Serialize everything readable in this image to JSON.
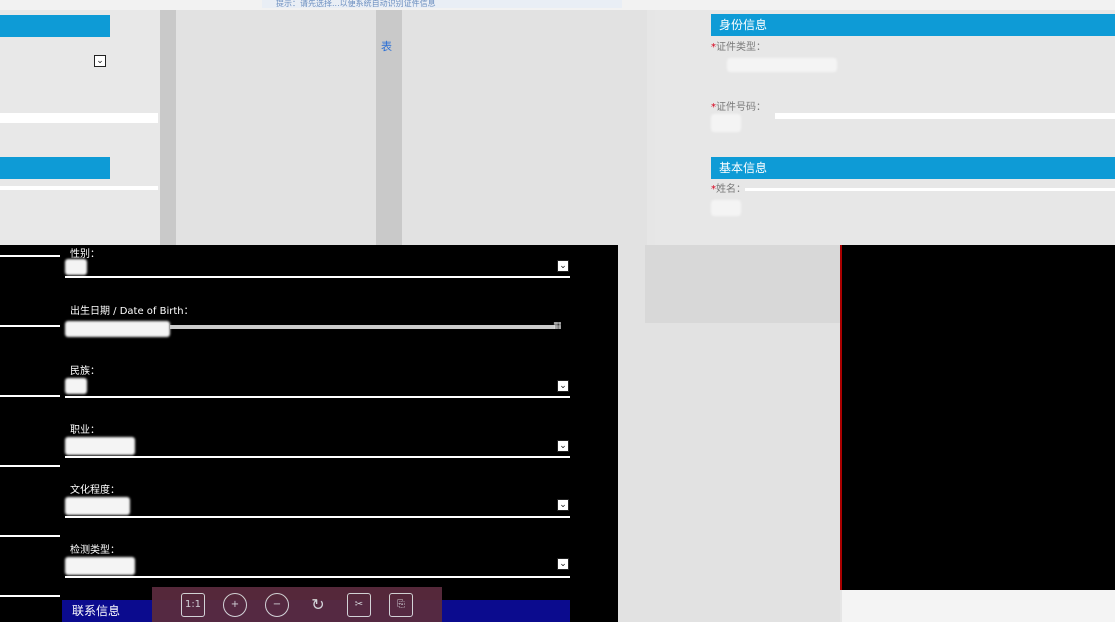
{
  "top": {
    "pale_link_text": "提示：请先选择...以便系统自动识别证件信息"
  },
  "right": {
    "identity_title": "身份信息",
    "id_type_label": "证件类型：",
    "id_number_label": "证件号码：",
    "basic_title": "基本信息",
    "name_label": "姓名："
  },
  "middle": {
    "tab_label": "表"
  },
  "form": {
    "gender_label": "性别：",
    "dob_label": "出生日期 / Date of Birth：",
    "ethnicity_label": "民族：",
    "occupation_label": "职业：",
    "education_label": "文化程度：",
    "detect_type_label": "检测类型：",
    "contact_title": "联系信息",
    "required_mark": "*"
  },
  "toolbar": {
    "actual_size": "1:1",
    "zoom_in": "+",
    "zoom_out": "−",
    "rotate": "↻",
    "crop": "✂",
    "save": "⎘"
  },
  "colors": {
    "accent": "#0e9bd6",
    "required": "#d6001c",
    "navy": "#0b0b8e"
  }
}
